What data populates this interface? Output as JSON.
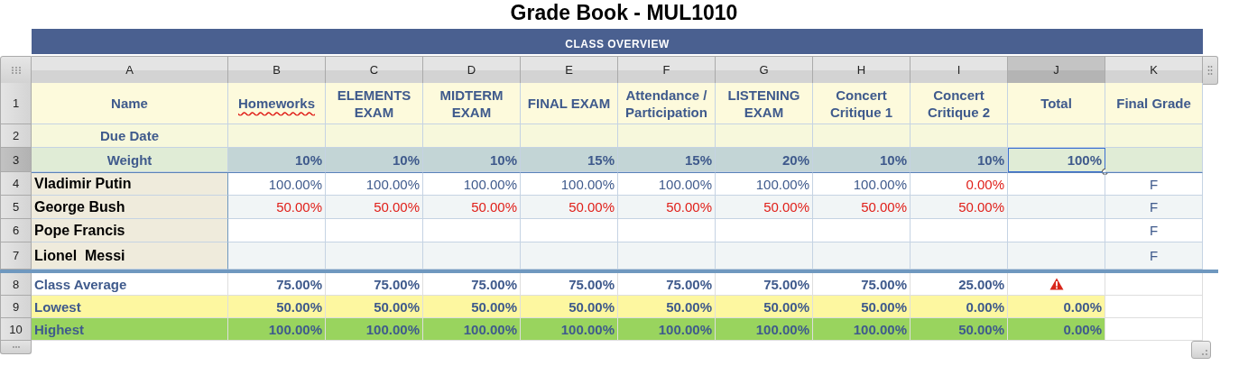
{
  "title": "Grade Book - MUL1010",
  "table": {
    "banner": "CLASS OVERVIEW",
    "column_letters": [
      {
        "label": "A",
        "selected": false
      },
      {
        "label": "B",
        "selected": false
      },
      {
        "label": "C",
        "selected": false
      },
      {
        "label": "D",
        "selected": false
      },
      {
        "label": "E",
        "selected": false
      },
      {
        "label": "F",
        "selected": false
      },
      {
        "label": "G",
        "selected": false
      },
      {
        "label": "H",
        "selected": false
      },
      {
        "label": "I",
        "selected": false
      },
      {
        "label": "J",
        "selected": true
      },
      {
        "label": "K",
        "selected": false
      }
    ],
    "row_numbers": [
      {
        "label": "1",
        "selected": false
      },
      {
        "label": "2",
        "selected": false
      },
      {
        "label": "3",
        "selected": true
      },
      {
        "label": "4",
        "selected": false
      },
      {
        "label": "5",
        "selected": false
      },
      {
        "label": "6",
        "selected": false
      },
      {
        "label": "7",
        "selected": false
      },
      {
        "label": "8",
        "selected": false
      },
      {
        "label": "9",
        "selected": false
      },
      {
        "label": "10",
        "selected": false
      }
    ],
    "headers": [
      {
        "label": "Name",
        "misspelled": false
      },
      {
        "label": "Homeworks",
        "misspelled": true
      },
      {
        "label": "ELEMENTS EXAM",
        "misspelled": false
      },
      {
        "label": "MIDTERM EXAM",
        "misspelled": false
      },
      {
        "label": "FINAL EXAM",
        "misspelled": false
      },
      {
        "label": "Attendance / Participation",
        "misspelled": false
      },
      {
        "label": "LISTENING EXAM",
        "misspelled": false
      },
      {
        "label": "Concert Critique 1",
        "misspelled": false
      },
      {
        "label": "Concert Critique 2",
        "misspelled": false
      },
      {
        "label": "Total",
        "misspelled": false
      },
      {
        "label": "Final Grade",
        "misspelled": false
      }
    ],
    "due_date_label": "Due Date",
    "weight": {
      "label": "Weight",
      "values": [
        "10%",
        "10%",
        "10%",
        "15%",
        "15%",
        "20%",
        "10%",
        "10%"
      ],
      "total": {
        "value": "100%",
        "selected": true
      }
    },
    "students": [
      {
        "name": "Vladimir Putin",
        "scores": [
          {
            "value": "100.00%",
            "failing": false
          },
          {
            "value": "100.00%",
            "failing": false
          },
          {
            "value": "100.00%",
            "failing": false
          },
          {
            "value": "100.00%",
            "failing": false
          },
          {
            "value": "100.00%",
            "failing": false
          },
          {
            "value": "100.00%",
            "failing": false
          },
          {
            "value": "100.00%",
            "failing": false
          },
          {
            "value": "0.00%",
            "failing": true
          }
        ],
        "final_grade": "F"
      },
      {
        "name": "George Bush",
        "scores": [
          {
            "value": "50.00%",
            "failing": true
          },
          {
            "value": "50.00%",
            "failing": true
          },
          {
            "value": "50.00%",
            "failing": true
          },
          {
            "value": "50.00%",
            "failing": true
          },
          {
            "value": "50.00%",
            "failing": true
          },
          {
            "value": "50.00%",
            "failing": true
          },
          {
            "value": "50.00%",
            "failing": true
          },
          {
            "value": "50.00%",
            "failing": true
          }
        ],
        "final_grade": "F"
      },
      {
        "name": "Pope Francis",
        "final_grade": "F"
      },
      {
        "name": "Lionel  Messi",
        "final_grade": "F"
      }
    ],
    "summary": [
      {
        "kind": "average",
        "label": "Class Average",
        "values": [
          "75.00%",
          "75.00%",
          "75.00%",
          "75.00%",
          "75.00%",
          "75.00%",
          "75.00%",
          "25.00%"
        ],
        "total_warning": true
      },
      {
        "kind": "lowest",
        "label": "Lowest",
        "values": [
          "50.00%",
          "50.00%",
          "50.00%",
          "50.00%",
          "50.00%",
          "50.00%",
          "50.00%",
          "0.00%"
        ],
        "total": "0.00%"
      },
      {
        "kind": "highest",
        "label": "Highest",
        "values": [
          "100.00%",
          "100.00%",
          "100.00%",
          "100.00%",
          "100.00%",
          "100.00%",
          "100.00%",
          "50.00%"
        ],
        "total": "0.00%"
      }
    ]
  }
}
